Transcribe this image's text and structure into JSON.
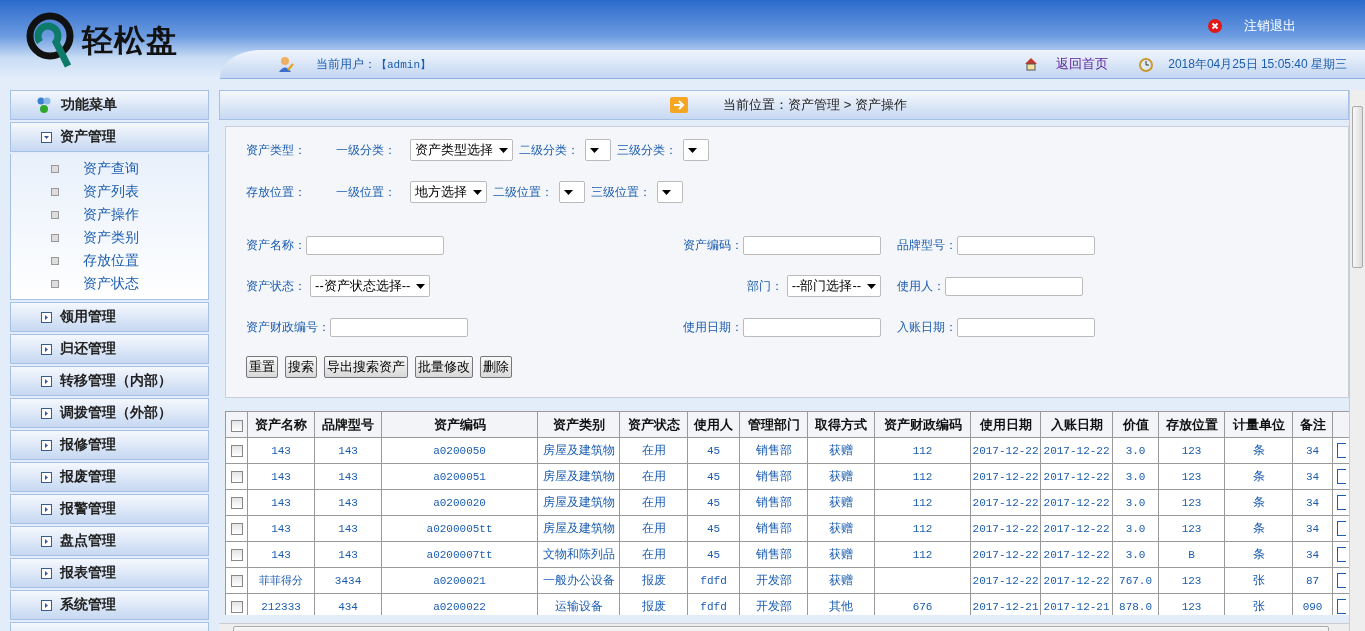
{
  "header": {
    "logo_text": "轻松盘",
    "logout": "注销退出",
    "current_user_label": "当前用户：",
    "current_user": "【admin】",
    "home_link": "返回首页",
    "datetime": "2018年04月25日 15:05:40 星期三"
  },
  "sidebar": {
    "title": "功能菜单",
    "groups": [
      {
        "label": "资产管理",
        "expanded": true,
        "items": [
          {
            "label": "资产查询"
          },
          {
            "label": "资产列表"
          },
          {
            "label": "资产操作"
          },
          {
            "label": "资产类别"
          },
          {
            "label": "存放位置"
          },
          {
            "label": "资产状态"
          }
        ]
      },
      {
        "label": "领用管理",
        "expanded": false
      },
      {
        "label": "归还管理",
        "expanded": false
      },
      {
        "label": "转移管理（内部）",
        "expanded": false
      },
      {
        "label": "调拨管理（外部）",
        "expanded": false
      },
      {
        "label": "报修管理",
        "expanded": false
      },
      {
        "label": "报废管理",
        "expanded": false
      },
      {
        "label": "报警管理",
        "expanded": false
      },
      {
        "label": "盘点管理",
        "expanded": false
      },
      {
        "label": "报表管理",
        "expanded": false
      },
      {
        "label": "系统管理",
        "expanded": false
      }
    ]
  },
  "breadcrumb": "当前位置：资产管理 > 资产操作",
  "category_rows": [
    {
      "label": "资产类型：",
      "selects": [
        {
          "label": "一级分类：",
          "value": "资产类型选择"
        },
        {
          "label": "二级分类："
        },
        {
          "label": "三级分类："
        }
      ]
    },
    {
      "label": "存放位置：",
      "selects": [
        {
          "label": "一级位置：",
          "value": "地方选择"
        },
        {
          "label": "二级位置："
        },
        {
          "label": "三级位置："
        }
      ]
    }
  ],
  "form_rows": [
    [
      {
        "label": "资产名称：",
        "kind": "input"
      },
      {
        "label": "资产编码：",
        "kind": "input"
      },
      {
        "label": "品牌型号：",
        "kind": "input"
      }
    ],
    [
      {
        "label": "资产状态：",
        "kind": "select",
        "value": "--资产状态选择--"
      },
      {
        "label": "部门：",
        "kind": "select",
        "value": "--部门选择--"
      },
      {
        "label": "使用人：",
        "kind": "input"
      }
    ],
    [
      {
        "label": "资产财政编号：",
        "kind": "input"
      },
      {
        "label": "使用日期：",
        "kind": "input"
      },
      {
        "label": "入账日期：",
        "kind": "input"
      }
    ]
  ],
  "buttons": [
    "重置",
    "搜索",
    "导出搜索资产",
    "批量修改",
    "删除"
  ],
  "table": {
    "select_all_checked": false,
    "columns": [
      "资产名称",
      "品牌型号",
      "资产编码",
      "资产类别",
      "资产状态",
      "使用人",
      "管理部门",
      "取得方式",
      "资产财政编码",
      "使用日期",
      "入账日期",
      "价值",
      "存放位置",
      "计量单位",
      "备注"
    ],
    "rows": [
      {
        "checked": false,
        "cells": [
          "143",
          "143",
          "a0200050",
          "房屋及建筑物",
          "在用",
          "45",
          "销售部",
          "获赠",
          "112",
          "2017-12-22",
          "2017-12-22",
          "3.0",
          "123",
          "条",
          "34"
        ]
      },
      {
        "checked": false,
        "cells": [
          "143",
          "143",
          "a0200051",
          "房屋及建筑物",
          "在用",
          "45",
          "销售部",
          "获赠",
          "112",
          "2017-12-22",
          "2017-12-22",
          "3.0",
          "123",
          "条",
          "34"
        ]
      },
      {
        "checked": false,
        "cells": [
          "143",
          "143",
          "a0200020",
          "房屋及建筑物",
          "在用",
          "45",
          "销售部",
          "获赠",
          "112",
          "2017-12-22",
          "2017-12-22",
          "3.0",
          "123",
          "条",
          "34"
        ]
      },
      {
        "checked": false,
        "cells": [
          "143",
          "143",
          "a0200005tt",
          "房屋及建筑物",
          "在用",
          "45",
          "销售部",
          "获赠",
          "112",
          "2017-12-22",
          "2017-12-22",
          "3.0",
          "123",
          "条",
          "34"
        ]
      },
      {
        "checked": false,
        "cells": [
          "143",
          "143",
          "a0200007tt",
          "文物和陈列品",
          "在用",
          "45",
          "销售部",
          "获赠",
          "112",
          "2017-12-22",
          "2017-12-22",
          "3.0",
          "B",
          "条",
          "34"
        ]
      },
      {
        "checked": false,
        "cells": [
          "菲菲得分",
          "3434",
          "a0200021",
          "一般办公设备",
          "报废",
          "fdfd",
          "开发部",
          "获赠",
          "",
          "2017-12-22",
          "2017-12-22",
          "767.0",
          "123",
          "张",
          "87"
        ]
      },
      {
        "checked": false,
        "cells": [
          "212333",
          "434",
          "a0200022",
          "运输设备",
          "报废",
          "fdfd",
          "开发部",
          "其他",
          "676",
          "2017-12-21",
          "2017-12-21",
          "878.0",
          "123",
          "张",
          "090"
        ]
      }
    ]
  }
}
